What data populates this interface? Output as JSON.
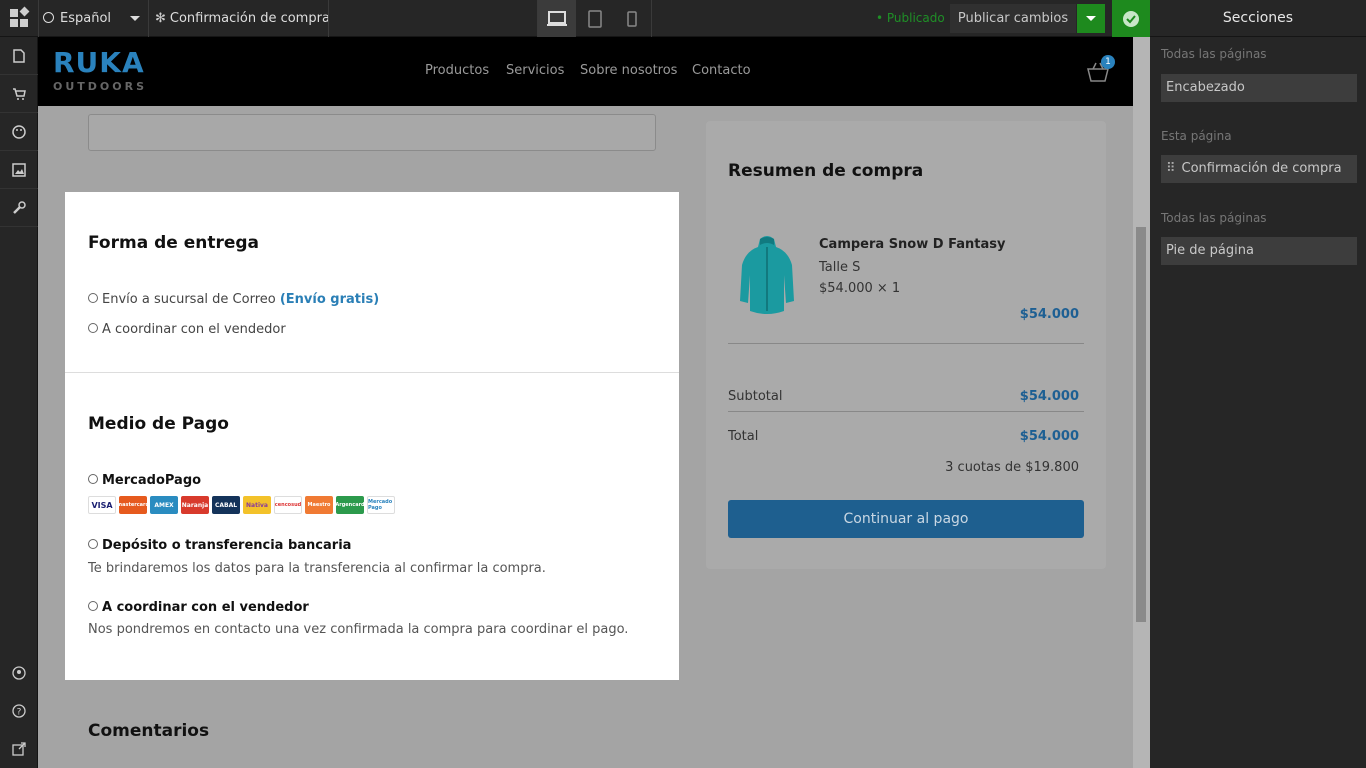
{
  "topbar": {
    "language": "Español",
    "page_name": "Confirmación de compra",
    "published_status": "• Publicado",
    "publish_button": "Publicar cambios"
  },
  "site": {
    "brand_top": "RUKA",
    "brand_bottom": "OUTDOORS",
    "nav": [
      "Productos",
      "Servicios",
      "Sobre nosotros",
      "Contacto"
    ],
    "cart_count": "1"
  },
  "delivery": {
    "title": "Forma de entrega",
    "option1_text": "Envío a sucursal de Correo ",
    "option1_tag": "(Envío gratis)",
    "option2_text": "A coordinar con el vendedor"
  },
  "payment": {
    "title": "Medio de Pago",
    "mercadopago_label": "MercadoPago",
    "cards": [
      "VISA",
      "mastercard",
      "AMEX",
      "Naranja",
      "CABAL",
      "Nativa",
      "cencosud",
      "Maestro",
      "Argencard",
      "Mercado Pago"
    ],
    "transfer_label": "Depósito o transferencia bancaria",
    "transfer_desc": "Te brindaremos los datos para la transferencia al confirmar la compra.",
    "coordinate_label": "A coordinar con el vendedor",
    "coordinate_desc": "Nos pondremos en contacto una vez confirmada la compra para coordinar el pago."
  },
  "comments": {
    "title": "Comentarios"
  },
  "summary": {
    "title": "Resumen de compra",
    "product_name": "Campera Snow D Fantasy",
    "product_size": "Talle S",
    "product_qty": "$54.000 × 1",
    "product_price": "$54.000",
    "subtotal_label": "Subtotal",
    "subtotal_value": "$54.000",
    "total_label": "Total",
    "total_value": "$54.000",
    "installments": "3 cuotas de $19.800",
    "pay_button": "Continuar al pago"
  },
  "panel": {
    "title": "Secciones",
    "all_pages_label_1": "Todas las páginas",
    "header_section": "Encabezado",
    "this_page_label": "Esta página",
    "page_section": "Confirmación de compra",
    "all_pages_label_2": "Todas las páginas",
    "footer_section": "Pie de página"
  },
  "colors": {
    "accent_blue": "#2a82bd",
    "publish_green": "#1e8a1e",
    "editor_dark": "#262626"
  }
}
